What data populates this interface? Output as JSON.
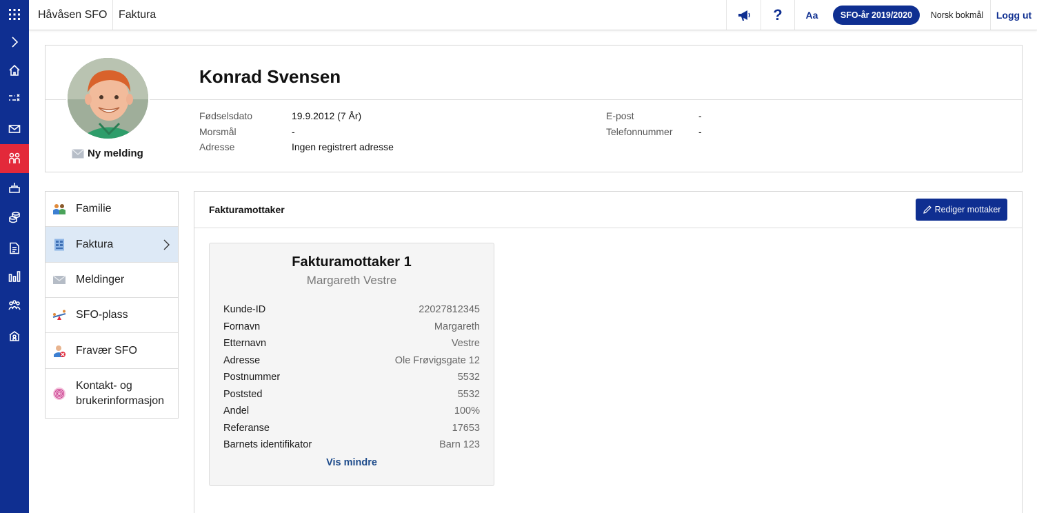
{
  "topbar": {
    "school_name": "Håvåsen SFO",
    "page_name": "Faktura",
    "help_glyph": "?",
    "font_size_label": "Aa",
    "school_year": "SFO-år 2019/2020",
    "language": "Norsk bokmål",
    "logout_label": "Logg ut"
  },
  "rail": {
    "icons": [
      "apps-grid-icon",
      "chevron-right-icon",
      "home-icon",
      "shuffle-icon",
      "mail-icon",
      "children-icon",
      "inbox-tray-icon",
      "coins-icon",
      "document-icon",
      "bar-chart-icon",
      "group-icon",
      "school-icon"
    ],
    "active_index": 5,
    "accent_color": "#0f2f91",
    "active_color": "#e3293a"
  },
  "profile": {
    "name": "Konrad Svensen",
    "new_message_label": "Ny melding",
    "fields_left": [
      {
        "label": "Fødselsdato",
        "value": "19.9.2012 (7 År)"
      },
      {
        "label": "Morsmål",
        "value": "-"
      },
      {
        "label": "Adresse",
        "value": "Ingen registrert adresse"
      }
    ],
    "fields_right": [
      {
        "label": "E-post",
        "value": "-"
      },
      {
        "label": "Telefonnummer",
        "value": "-"
      }
    ]
  },
  "sidemenu": {
    "items": [
      {
        "label": "Familie",
        "icon": "family-icon"
      },
      {
        "label": "Faktura",
        "icon": "invoice-icon",
        "active": true
      },
      {
        "label": "Meldinger",
        "icon": "envelope-icon"
      },
      {
        "label": "SFO-plass",
        "icon": "seesaw-icon"
      },
      {
        "label": "Fravær SFO",
        "icon": "absence-icon"
      },
      {
        "label": "Kontakt- og brukerinformasjon",
        "icon": "fingerprint-icon"
      }
    ]
  },
  "panel": {
    "title": "Fakturamottaker",
    "edit_label": "Rediger mottaker",
    "recipient": {
      "title": "Fakturamottaker 1",
      "subtitle": "Margareth Vestre",
      "rows": [
        {
          "key": "Kunde-ID",
          "value": "22027812345"
        },
        {
          "key": "Fornavn",
          "value": "Margareth"
        },
        {
          "key": "Etternavn",
          "value": "Vestre"
        },
        {
          "key": "Adresse",
          "value": "Ole Frøvigsgate 12"
        },
        {
          "key": "Postnummer",
          "value": "5532"
        },
        {
          "key": "Poststed",
          "value": "5532"
        },
        {
          "key": "Andel",
          "value": "100%"
        },
        {
          "key": "Referanse",
          "value": "17653"
        },
        {
          "key": "Barnets identifikator",
          "value": "Barn 123"
        }
      ],
      "toggle_label": "Vis mindre"
    }
  }
}
